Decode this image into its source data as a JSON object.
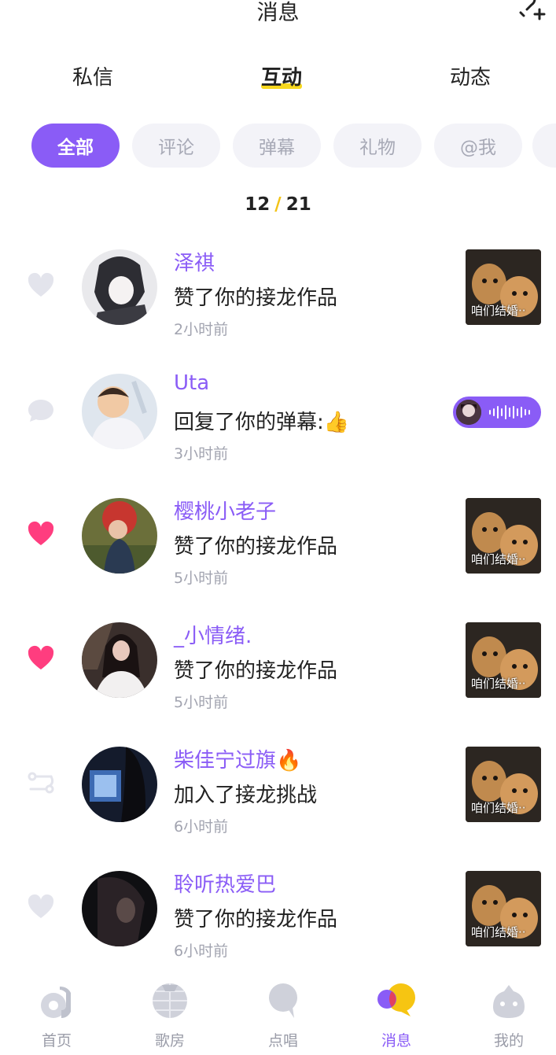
{
  "header": {
    "title": "消息"
  },
  "tabs": [
    {
      "label": "私信"
    },
    {
      "label": "互动"
    },
    {
      "label": "动态"
    }
  ],
  "filters": [
    {
      "label": "全部"
    },
    {
      "label": "评论"
    },
    {
      "label": "弹幕"
    },
    {
      "label": "礼物"
    },
    {
      "label": "@我"
    }
  ],
  "pager": {
    "current": "12",
    "separator": "/",
    "total": "21"
  },
  "thumb_caption": "咱们结婚··",
  "items": [
    {
      "name": "泽祺",
      "message": "赞了你的接龙作品",
      "time": "2小时前",
      "icon": "heart-icon"
    },
    {
      "name": "Uta",
      "message": "回复了你的弹幕:👍",
      "time": "3小时前",
      "icon": "comment-bubble-icon"
    },
    {
      "name": "樱桃小老子",
      "message": "赞了你的接龙作品",
      "time": "5小时前",
      "icon": "heart-filled-icon"
    },
    {
      "name": "_小情绪.",
      "message": "赞了你的接龙作品",
      "time": "5小时前",
      "icon": "heart-filled-icon"
    },
    {
      "name": "柴佳宁过旗🔥",
      "message": "加入了接龙挑战",
      "time": "6小时前",
      "icon": "relay-icon"
    },
    {
      "name": "聆听热爱巴",
      "message": "赞了你的接龙作品",
      "time": "6小时前",
      "icon": "heart-icon"
    }
  ],
  "nav": [
    {
      "label": "首页"
    },
    {
      "label": "歌房"
    },
    {
      "label": "点唱"
    },
    {
      "label": "消息"
    },
    {
      "label": "我的"
    }
  ],
  "colors": {
    "accent": "#8a5cf6",
    "highlight": "#f7d81e",
    "like": "#ff3d7f",
    "muted": "#e3e4ec"
  }
}
